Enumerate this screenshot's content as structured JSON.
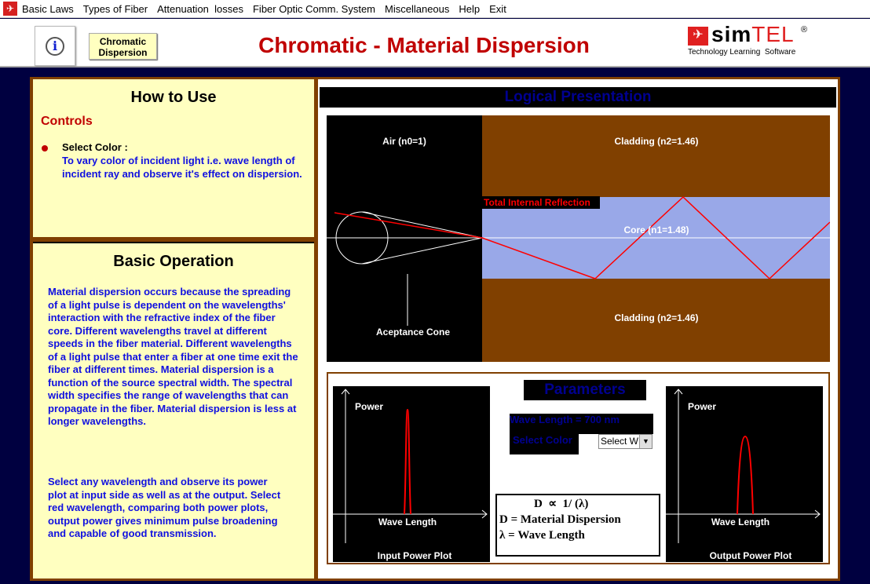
{
  "menu": [
    "Basic Laws",
    "Types of Fiber",
    "Attenuation  losses",
    "Fiber Optic Comm. System",
    "Miscellaneous",
    "Help",
    "Exit"
  ],
  "header": {
    "chromatic_btn_line1": "Chromatic",
    "chromatic_btn_line2": "Dispersion",
    "title": "Chromatic - Material Dispersion",
    "brand": "simTEL",
    "brand_tagline": "Technology Learning  Software",
    "brand_mark": "®"
  },
  "how_to_use": {
    "title": "How to Use",
    "controls": "Controls",
    "item_title": "Select Color :",
    "item_text": "To vary color of incident light i.e. wave length of incident ray and observe it's effect on dispersion."
  },
  "basic_operation": {
    "title": "Basic Operation",
    "para1": "Material dispersion occurs because the spreading of a light pulse is dependent on the wavelengths' interaction with the refractive index of the fiber core. Different wavelengths travel at different speeds in the fiber material. Different wavelengths of a light pulse that enter a fiber at one time exit the fiber at different times. Material dispersion is a function of the source spectral width. The spectral width specifies the range of wavelengths that can propagate in the fiber. Material dispersion is less at longer wavelengths.",
    "para2": "Select any wavelength and observe its power plot at input side as well as at the output. Select red wavelength, comparing both power plots, output power gives minimum pulse broadening and capable of good transmission."
  },
  "logical": {
    "title": "Logical Presentation",
    "air": "Air (n0=1)",
    "cladding_top": "Cladding (n2=1.46)",
    "core": "Core (n1=1.48)",
    "cladding_bottom": "Cladding (n2=1.46)",
    "tir": "Total Internal Reflection",
    "cone": "Aceptance Cone"
  },
  "parameters": {
    "title": "Parameters",
    "wavelength": "Wave Length = 700 nm",
    "select_color": "Select Color",
    "select_value": "Select W",
    "formula1": "D  ∝  1/ (λ)",
    "formula2": "D = Material Dispersion",
    "formula3": "λ = Wave Length"
  },
  "input_plot": {
    "ylabel": "Power",
    "xlabel": "Wave Length",
    "caption": "Input Power Plot"
  },
  "output_plot": {
    "ylabel": "Power",
    "xlabel": "Wave Length",
    "caption": "Output Power Plot"
  },
  "colors": {
    "ray": "#ff0000",
    "cladding": "#804000",
    "core": "#99a8e8",
    "panel": "#ffffc0",
    "title": "#c00000"
  }
}
